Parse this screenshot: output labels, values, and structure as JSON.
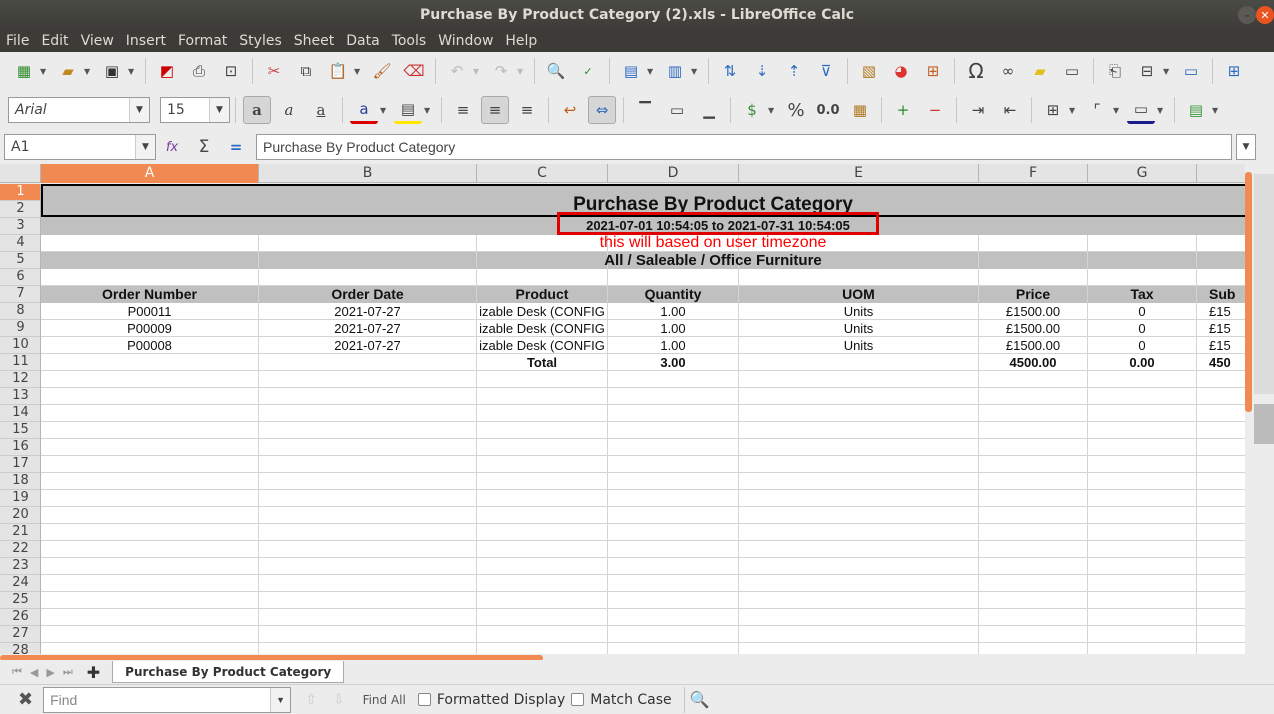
{
  "window": {
    "title": "Purchase By Product Category (2).xls - LibreOffice Calc"
  },
  "menu": [
    "File",
    "Edit",
    "View",
    "Insert",
    "Format",
    "Styles",
    "Sheet",
    "Data",
    "Tools",
    "Window",
    "Help"
  ],
  "font": {
    "name": "Arial",
    "size": "15"
  },
  "formula": {
    "cell_ref": "A1",
    "content": "Purchase By Product Category"
  },
  "columns": [
    "A",
    "B",
    "C",
    "D",
    "E",
    "F",
    "G"
  ],
  "rows": [
    "1",
    "2",
    "3",
    "4",
    "5",
    "6",
    "7",
    "8",
    "9",
    "10",
    "11",
    "12",
    "13",
    "14",
    "15",
    "16",
    "17",
    "18",
    "19",
    "20",
    "21",
    "22",
    "23",
    "24",
    "25",
    "26",
    "27",
    "28"
  ],
  "report": {
    "title": "Purchase By Product Category",
    "date_range": "2021-07-01 10:54:05 to 2021-07-31 10:54:05",
    "note": "this will based on user timezone",
    "category": "All / Saleable / Office Furniture"
  },
  "table": {
    "headers": [
      "Order Number",
      "Order Date",
      "Product",
      "Quantity",
      "UOM",
      "Price",
      "Tax",
      "Sub"
    ],
    "rows": [
      [
        "P00011",
        "2021-07-27",
        "izable Desk (CONFIG",
        "1.00",
        "Units",
        "£1500.00",
        "0",
        "£15"
      ],
      [
        "P00009",
        "2021-07-27",
        "izable Desk (CONFIG",
        "1.00",
        "Units",
        "£1500.00",
        "0",
        "£15"
      ],
      [
        "P00008",
        "2021-07-27",
        "izable Desk (CONFIG",
        "1.00",
        "Units",
        "£1500.00",
        "0",
        "£15"
      ]
    ],
    "total": {
      "label": "Total",
      "quantity": "3.00",
      "price": "4500.00",
      "tax": "0.00",
      "sub": "450"
    }
  },
  "sheet_tab": "Purchase By Product Category",
  "findbar": {
    "placeholder": "Find",
    "find_all": "Find All",
    "formatted_display": "Formatted Display",
    "match_case": "Match Case"
  },
  "colors": {
    "highlight_box": "#e00000",
    "note_text": "#ff0000",
    "band": "#c0c0c0",
    "active_col": "#f08a52"
  }
}
